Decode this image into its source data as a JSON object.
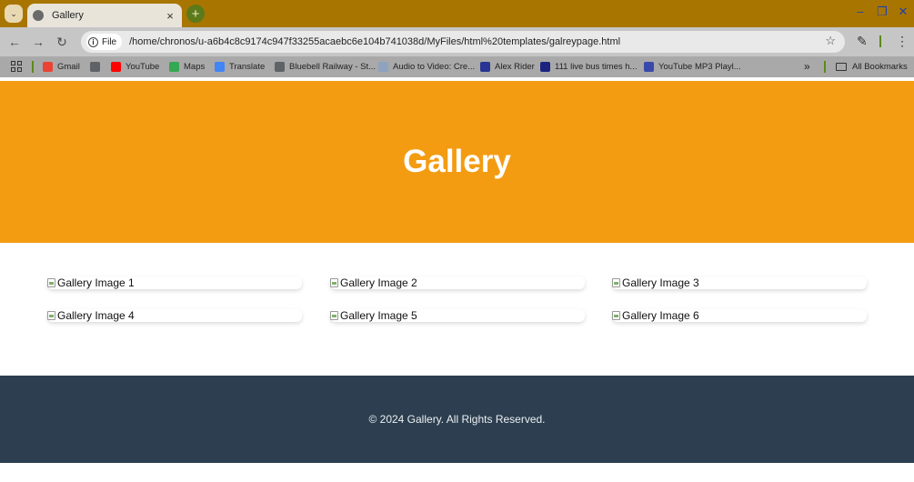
{
  "browser": {
    "tab_title": "Gallery",
    "url_chip": "File",
    "url": "/home/chronos/u-a6b4c8c9174c947f33255acaebc6e104b741038d/MyFiles/html%20templates/galreypage.html",
    "bookmarks": [
      {
        "label": "Gmail",
        "color": "#ea4335"
      },
      {
        "label": "",
        "color": "#5f6368"
      },
      {
        "label": "YouTube",
        "color": "#ff0000"
      },
      {
        "label": "Maps",
        "color": "#34a853"
      },
      {
        "label": "Translate",
        "color": "#4285f4"
      },
      {
        "label": "Bluebell Railway - St...",
        "color": "#5f6368"
      },
      {
        "label": "Audio to Video: Cre...",
        "color": "#8fa3c0"
      },
      {
        "label": "Alex Rider",
        "color": "#283593"
      },
      {
        "label": "111 live bus times h...",
        "color": "#1a237e"
      },
      {
        "label": "YouTube MP3 Playl...",
        "color": "#3949ab"
      }
    ],
    "all_bookmarks": "All Bookmarks"
  },
  "page": {
    "header_title": "Gallery",
    "images": [
      {
        "alt": "Gallery Image 1"
      },
      {
        "alt": "Gallery Image 2"
      },
      {
        "alt": "Gallery Image 3"
      },
      {
        "alt": "Gallery Image 4"
      },
      {
        "alt": "Gallery Image 5"
      },
      {
        "alt": "Gallery Image 6"
      }
    ],
    "footer_text": "© 2024 Gallery. All Rights Reserved."
  },
  "colors": {
    "frame": "#a87600",
    "header_bg": "#f39c12",
    "footer_bg": "#2c3e50"
  }
}
